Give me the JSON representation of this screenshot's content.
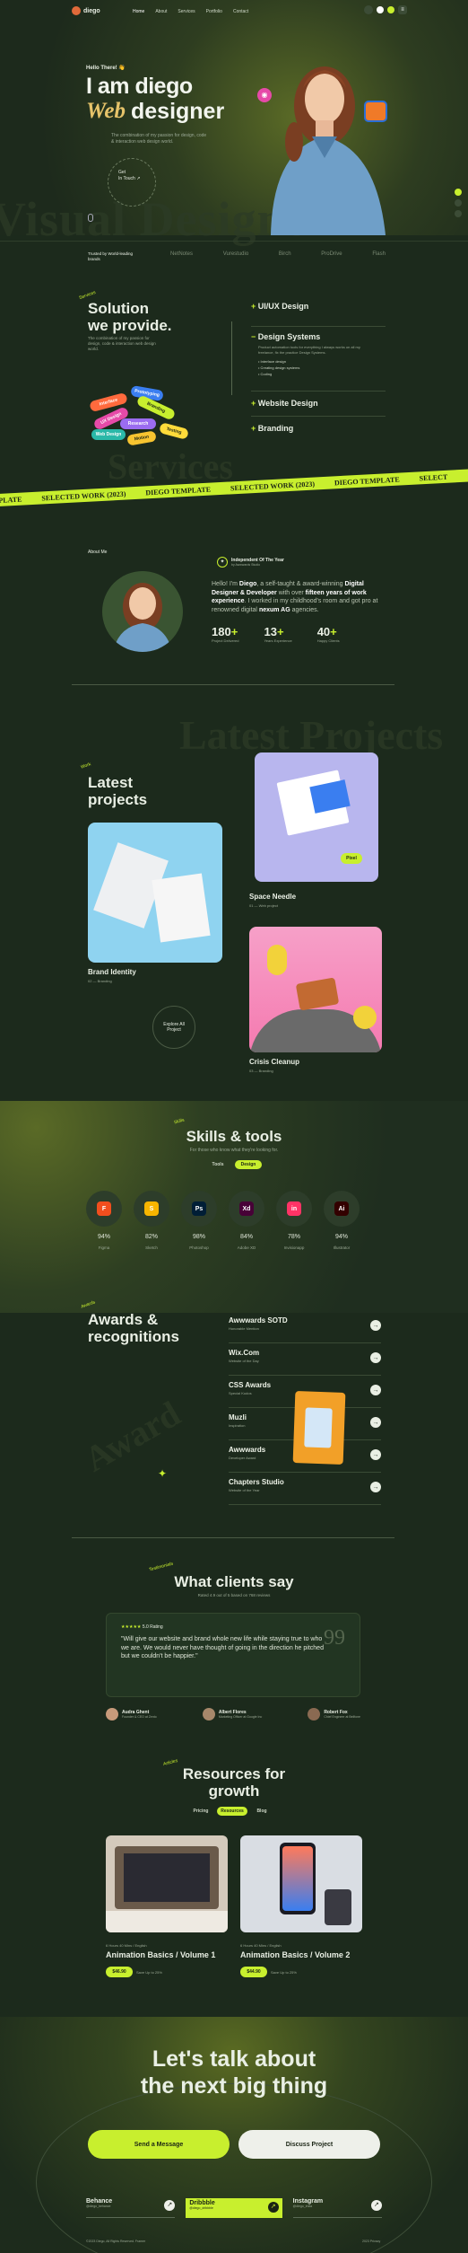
{
  "colors": {
    "accent": "#c8ef2e",
    "bg": "#1c2a1c",
    "card": "#223522"
  },
  "nav": {
    "logo": "diego",
    "links": [
      "Home",
      "About",
      "Services",
      "Portfolio",
      "Contact"
    ]
  },
  "hero": {
    "greeting": "Hello There! 👋",
    "line1": "I am diego",
    "word_accent": "Web",
    "word_rest": "designer",
    "desc": "The combination of my passion for design, code & interaction web design world.",
    "cta_small": "Get",
    "cta_small2": "In Touch ↗",
    "ghost": "Visual Designer"
  },
  "trusted": {
    "label": "Trusted by World-leading brands",
    "brands": [
      "NetNotes",
      "Vurestudio",
      "Birch",
      "ProDrive",
      "Flash"
    ]
  },
  "solution": {
    "badge": "Services",
    "title1": "Solution",
    "title2": "we provide.",
    "desc": "The combination of my passion for design, code & interaction web design world.",
    "tags": [
      "Interface",
      "Prototyping",
      "Branding",
      "UX Design",
      "Research",
      "Web Design",
      "Motion",
      "Testing"
    ],
    "services": [
      {
        "name": "UI/UX Design"
      },
      {
        "name": "Design Systems",
        "desc": "Product automation tools for everything I always works on all my freelance, fix the practice Design Systems.",
        "items": [
          "Interface design",
          "Creating design systems",
          "Coding"
        ]
      },
      {
        "name": "Website Design"
      },
      {
        "name": "Branding"
      }
    ],
    "ghost": "Services"
  },
  "marquee": [
    "SELECTED WORK (2023)",
    "DIEGO TEMPLATE",
    "SELECTED WORK (2023)",
    "DIEGO TEMPLATE",
    "SELECT",
    "PLATE"
  ],
  "about": {
    "label": "About Me",
    "badge_title": "Independent Of The Year",
    "badge_sub": "by Awwwards Studio",
    "text_pre": "Hello! I'm",
    "name": "Diego",
    "text_1": ", a self-taught & award-winning",
    "role": "Digital Designer & Developer",
    "text_2": "with over",
    "years": "fifteen years of work experience",
    "text_3": ". I worked in my childhood's room and got pro at renowned digital",
    "agency": "nexum AG",
    "text_4": "agencies.",
    "stats": [
      {
        "value": "180",
        "plus": "+",
        "label": "Project Delivered"
      },
      {
        "value": "13",
        "plus": "+",
        "label": "Years Experience"
      },
      {
        "value": "40",
        "plus": "+",
        "label": "Happy Clients"
      }
    ]
  },
  "projects": {
    "badge": "Work",
    "title1": "Latest",
    "title2": "projects",
    "ghost": "Latest Projects",
    "explore": "Explore All Project",
    "items": [
      {
        "name": "Space Needle",
        "tag": "01 — Web project",
        "chip": "Pixel"
      },
      {
        "name": "Brand Identity",
        "tag": "02 — Branding"
      },
      {
        "name": "Crisis Cleanup",
        "tag": "03 — Branding"
      }
    ]
  },
  "skills": {
    "badge": "Skills",
    "title": "Skills & tools",
    "sub": "For those who know what they're looking for.",
    "tabs": [
      "Tools",
      "Design"
    ],
    "tools": [
      {
        "name": "Figma",
        "pct": "94%",
        "icon": "figma-icon",
        "color": "#f24e1e",
        "glyph": "F"
      },
      {
        "name": "Sketch",
        "pct": "82%",
        "icon": "sketch-icon",
        "color": "#f7b500",
        "glyph": "S"
      },
      {
        "name": "Photoshop",
        "pct": "98%",
        "icon": "photoshop-icon",
        "color": "#001e36",
        "glyph": "Ps"
      },
      {
        "name": "Adobe XD",
        "pct": "84%",
        "icon": "xd-icon",
        "color": "#470137",
        "glyph": "Xd"
      },
      {
        "name": "Invisionapp",
        "pct": "78%",
        "icon": "invision-icon",
        "color": "#ff3366",
        "glyph": "in"
      },
      {
        "name": "Illustrator",
        "pct": "94%",
        "icon": "illustrator-icon",
        "color": "#330000",
        "glyph": "Ai"
      }
    ]
  },
  "awards": {
    "badge": "Awards",
    "title1": "Awards &",
    "title2": "recognitions",
    "ghost": "Award",
    "items": [
      {
        "name": "Awwwards SOTD",
        "sub": "Honorable Mention"
      },
      {
        "name": "Wix.Com",
        "sub": "Website of the Day"
      },
      {
        "name": "CSS Awards",
        "sub": "Special Kudos"
      },
      {
        "name": "Muzli",
        "sub": "Inspiration"
      },
      {
        "name": "Awwwards",
        "sub": "Developer Award"
      },
      {
        "name": "Chapters Studio",
        "sub": "Website of the Year"
      }
    ]
  },
  "testimonials": {
    "badge": "Testimonials",
    "title": "What clients say",
    "sub": "Rated 4.9 out of 5 based on 768 reviews",
    "stars": "★★★★★",
    "rating": "5.0 Rating",
    "quote": "\"Will give our website and brand whole new life while staying true to who we are. We would never have thought of going in the direction he pitched but we couldn't be happier.\"",
    "people": [
      {
        "name": "Audra Ghent",
        "role": "Founder & CEO at Zento"
      },
      {
        "name": "Albert Flores",
        "role": "Marketing Officer at Google Inc"
      },
      {
        "name": "Robert Fox",
        "role": "Chief Engineer at Bellfone"
      }
    ]
  },
  "resources": {
    "badge": "Articles",
    "title1": "Resources for",
    "title2": "growth",
    "tabs": [
      "Pricing",
      "Resources",
      "Blog"
    ],
    "items": [
      {
        "meta": "6 Hours 40 Mins / English",
        "title": "Animation Basics / Volume 1",
        "price": "$46.90",
        "old": "Save Up to 25%"
      },
      {
        "meta": "6 Hours 40 Mins / English",
        "title": "Animation Basics / Volume 2",
        "price": "$44.90",
        "old": "Save Up to 25%"
      }
    ]
  },
  "cta": {
    "line1": "Let's talk about",
    "line2": "the next big thing",
    "btn1": "Send a Message",
    "btn2": "Discuss Project"
  },
  "footer": {
    "socials": [
      {
        "name": "Behance",
        "sub": "@diego_behance"
      },
      {
        "name": "Dribbble",
        "sub": "@diego_dribbble"
      },
      {
        "name": "Instagram",
        "sub": "@diego_insta"
      }
    ],
    "copyright": "©2023 Diego, All Rights Reserved. Framer",
    "license": "2023 Privacy"
  }
}
